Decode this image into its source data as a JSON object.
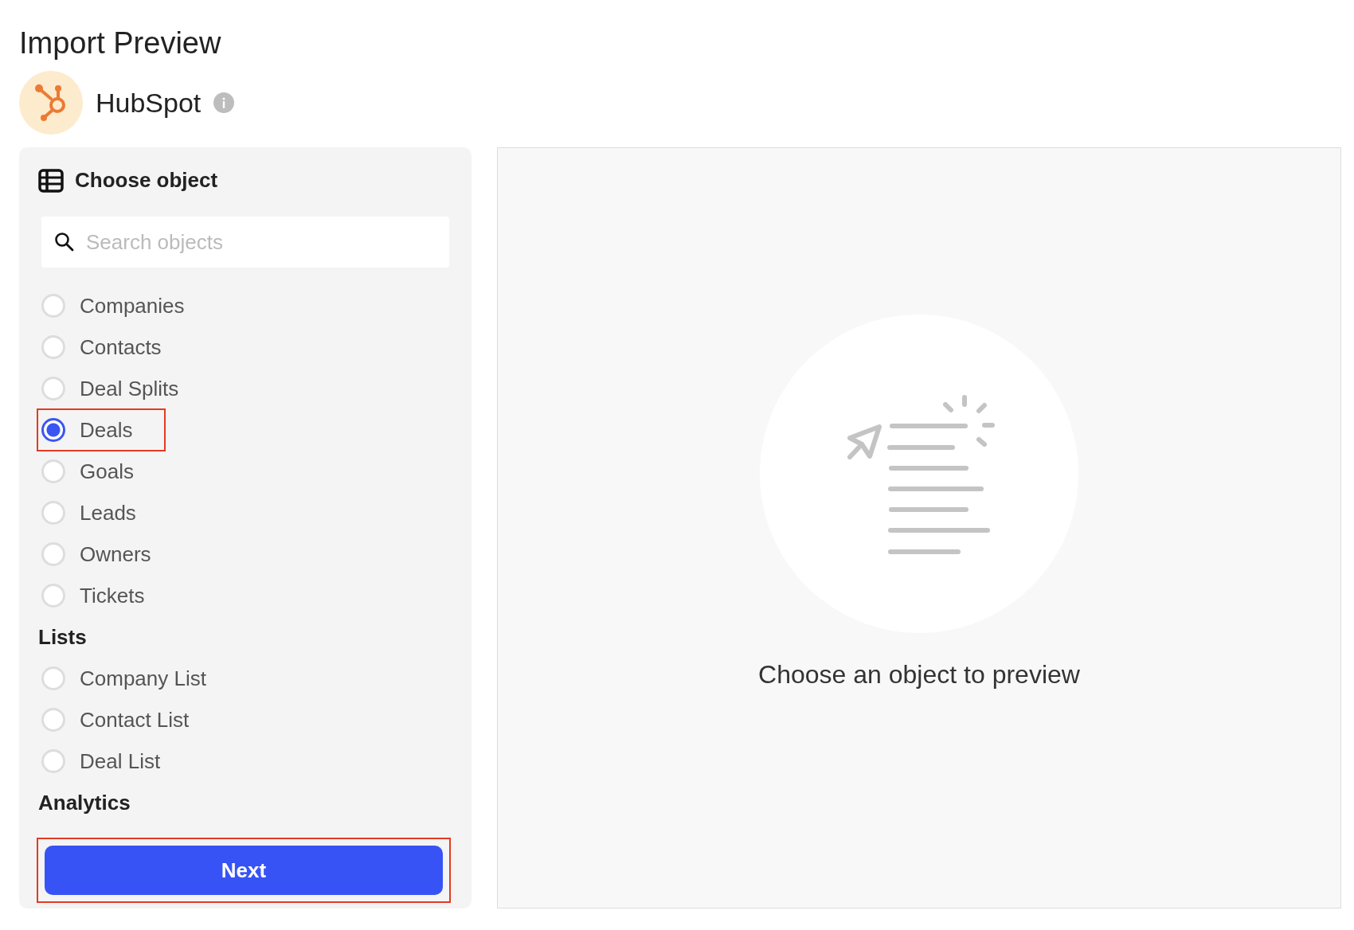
{
  "page": {
    "title": "Import Preview"
  },
  "source": {
    "name": "HubSpot"
  },
  "chooser": {
    "title": "Choose object",
    "search": {
      "placeholder": "Search objects"
    },
    "groups": [
      {
        "items": [
          {
            "label": "Companies",
            "selected": false,
            "highlighted": false
          },
          {
            "label": "Contacts",
            "selected": false,
            "highlighted": false
          },
          {
            "label": "Deal Splits",
            "selected": false,
            "highlighted": false
          },
          {
            "label": "Deals",
            "selected": true,
            "highlighted": true
          },
          {
            "label": "Goals",
            "selected": false,
            "highlighted": false
          },
          {
            "label": "Leads",
            "selected": false,
            "highlighted": false
          },
          {
            "label": "Owners",
            "selected": false,
            "highlighted": false
          },
          {
            "label": "Tickets",
            "selected": false,
            "highlighted": false
          }
        ]
      },
      {
        "heading": "Lists",
        "items": [
          {
            "label": "Company List",
            "selected": false,
            "highlighted": false
          },
          {
            "label": "Contact List",
            "selected": false,
            "highlighted": false
          },
          {
            "label": "Deal List",
            "selected": false,
            "highlighted": false
          }
        ]
      },
      {
        "heading": "Analytics"
      }
    ]
  },
  "next_button": {
    "label": "Next",
    "highlighted": true
  },
  "preview": {
    "message": "Choose an object to preview"
  }
}
